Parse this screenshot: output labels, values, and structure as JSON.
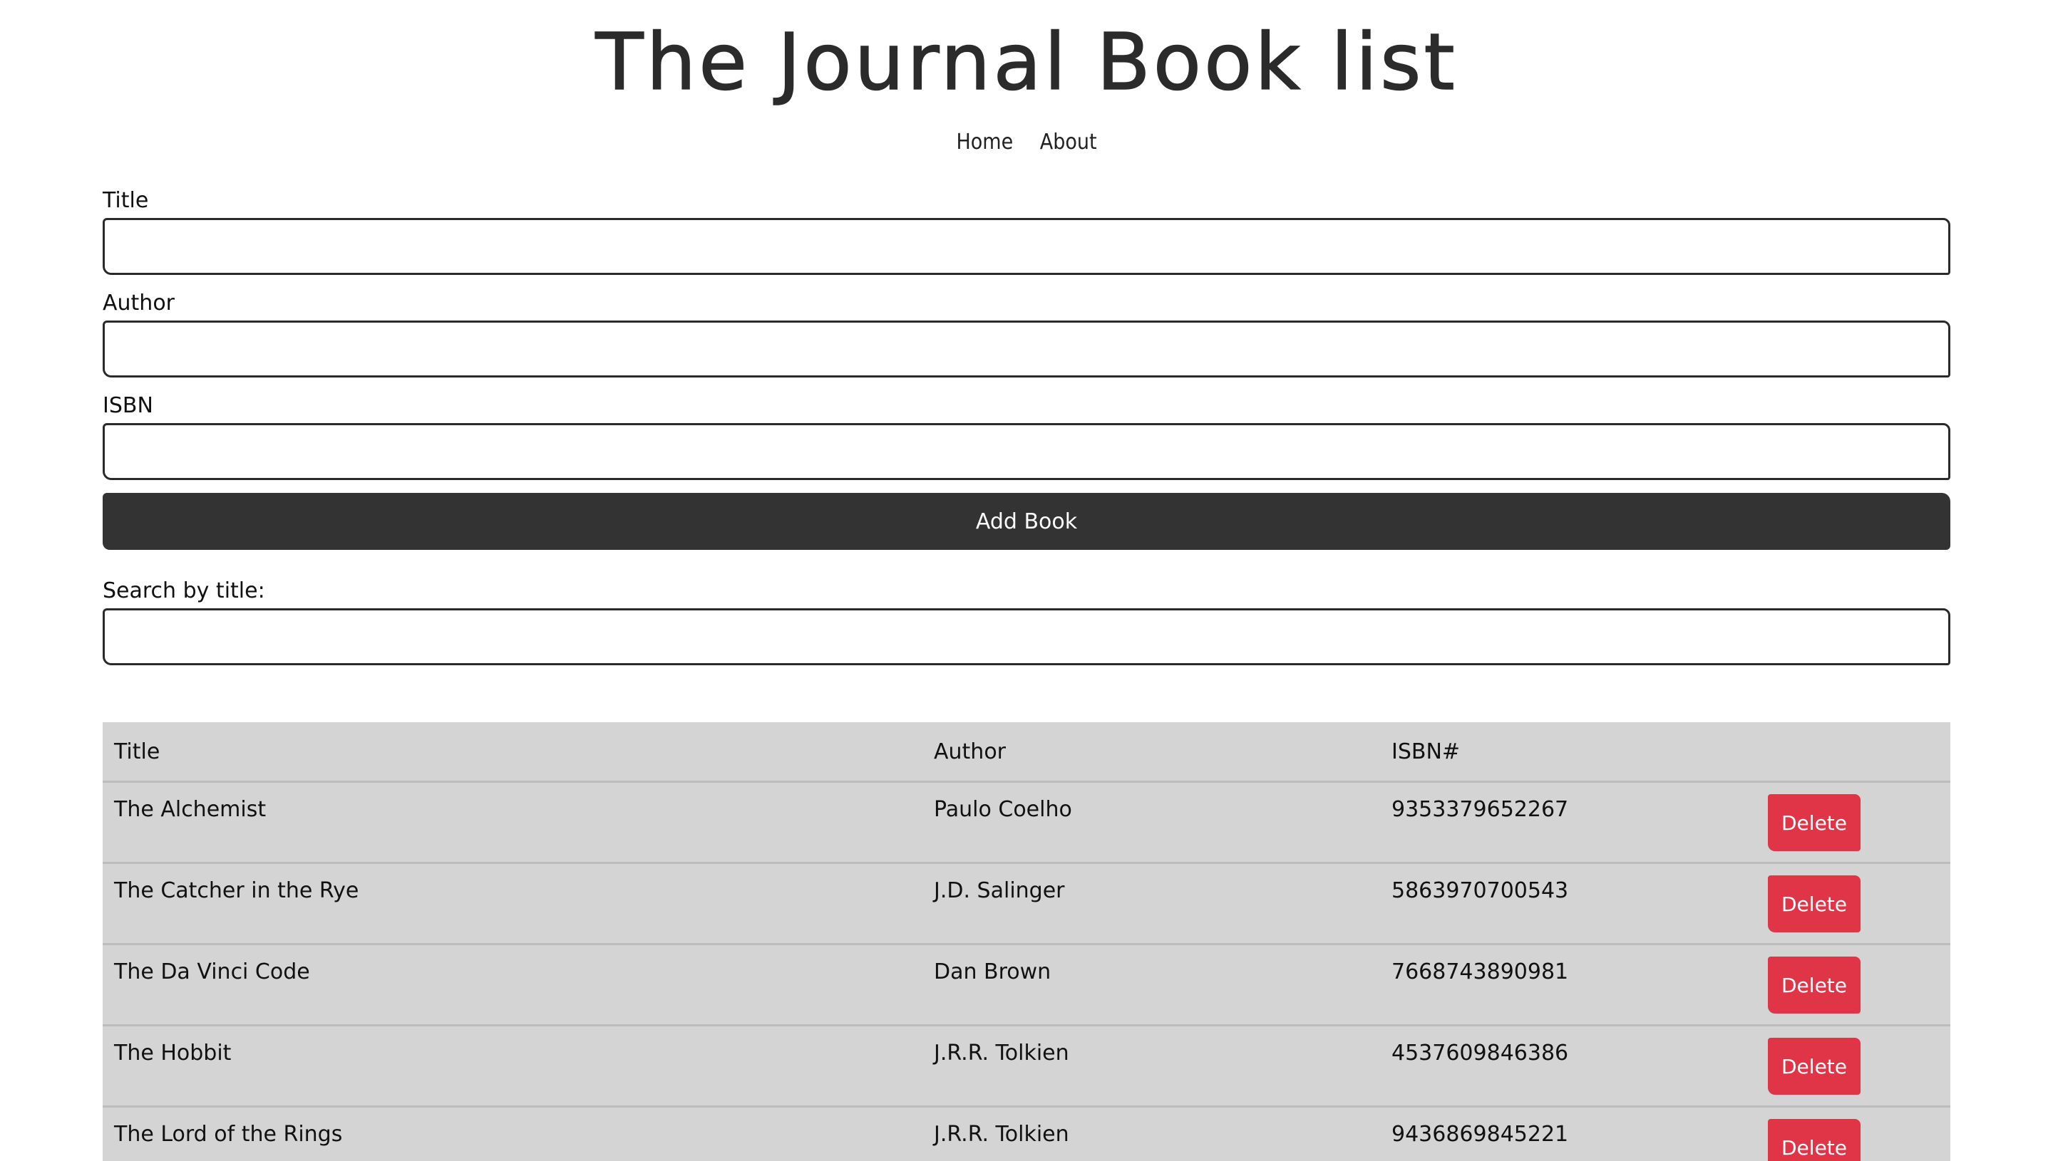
{
  "header": {
    "title": "The Journal Book list",
    "nav": [
      {
        "label": "Home"
      },
      {
        "label": "About"
      }
    ]
  },
  "form": {
    "title_label": "Title",
    "title_value": "",
    "author_label": "Author",
    "author_value": "",
    "isbn_label": "ISBN",
    "isbn_value": "",
    "submit_label": "Add Book"
  },
  "search": {
    "label": "Search by title:",
    "value": ""
  },
  "table": {
    "headers": {
      "title": "Title",
      "author": "Author",
      "isbn": "ISBN#"
    },
    "delete_label": "Delete",
    "rows": [
      {
        "title": "The Alchemist",
        "author": "Paulo Coelho",
        "isbn": "9353379652267"
      },
      {
        "title": "The Catcher in the Rye",
        "author": "J.D. Salinger",
        "isbn": "5863970700543"
      },
      {
        "title": "The Da Vinci Code",
        "author": "Dan Brown",
        "isbn": "7668743890981"
      },
      {
        "title": "The Hobbit",
        "author": "J.R.R. Tolkien",
        "isbn": "4537609846386"
      },
      {
        "title": "The Lord of the Rings",
        "author": "J.R.R. Tolkien",
        "isbn": "9436869845221"
      }
    ]
  },
  "colors": {
    "primary_button": "#333333",
    "delete_button": "#e03547",
    "table_background": "#d4d4d4"
  }
}
